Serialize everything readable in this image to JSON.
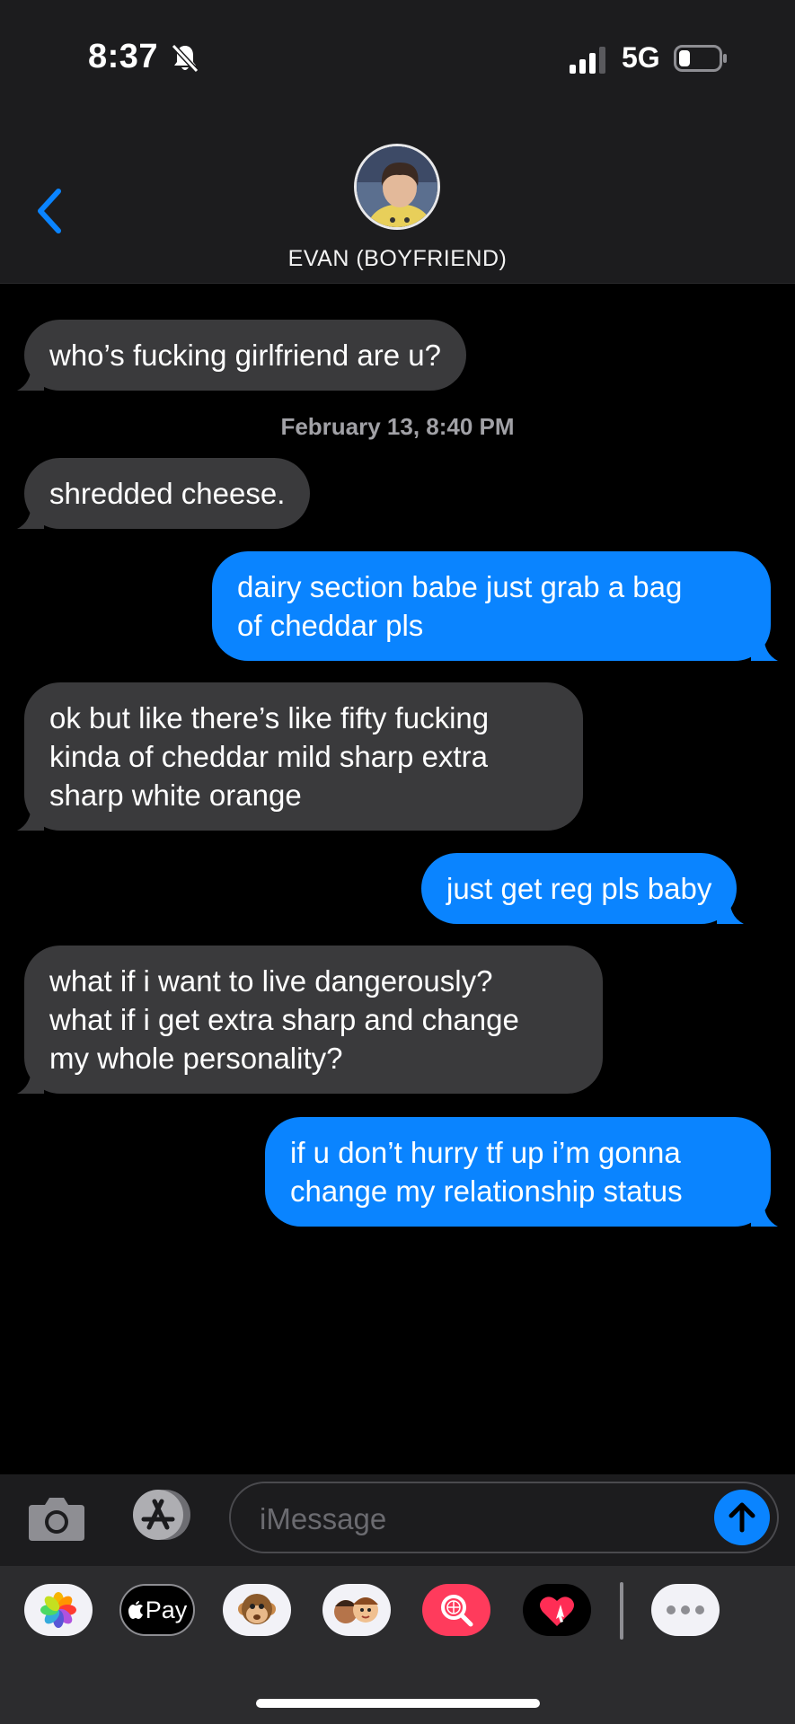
{
  "status_bar": {
    "time": "8:37",
    "network": "5G",
    "icons": [
      "bell-slash-icon",
      "cellular-signal-icon",
      "battery-icon"
    ]
  },
  "header": {
    "contact_name": "EVAN (BOYFRIEND)",
    "back_icon": "chevron-left-icon",
    "avatar": "contact-avatar"
  },
  "messages": [
    {
      "direction": "incoming",
      "text": "who’s fucking girlfriend are u?"
    },
    {
      "timestamp": "February 13, 8:40 PM"
    },
    {
      "direction": "incoming",
      "text": "shredded cheese."
    },
    {
      "direction": "outgoing",
      "lines": [
        "dairy section babe just grab a bag",
        "of cheddar pls"
      ]
    },
    {
      "direction": "incoming",
      "lines": [
        "ok but like there’s like fifty fucking",
        "kinda of cheddar mild sharp extra",
        "sharp white orange"
      ]
    },
    {
      "direction": "outgoing",
      "text": "just get reg pls baby"
    },
    {
      "direction": "incoming",
      "lines": [
        "what if i want to live dangerously?",
        "what if i get extra sharp and change",
        "my whole personality?"
      ]
    },
    {
      "direction": "outgoing",
      "lines": [
        "if u don’t hurry tf up i’m gonna",
        "change my relationship status"
      ]
    }
  ],
  "input_bar": {
    "placeholder": "iMessage",
    "buttons": [
      "camera-icon",
      "app-store-icon",
      "send-arrow-icon"
    ]
  },
  "app_drawer": {
    "apple_pay_label": "Pay",
    "apps": [
      "photos-icon",
      "apple-pay-icon",
      "monkey-memoji-icon",
      "memoji-stickers-icon",
      "image-search-icon",
      "digital-touch-icon",
      "more-icon"
    ]
  },
  "colors": {
    "incoming_bubble": "#3a3a3c",
    "outgoing_bubble": "#0a84ff",
    "header_bg": "#1c1c1e",
    "timestamp": "#a1a1a6"
  }
}
